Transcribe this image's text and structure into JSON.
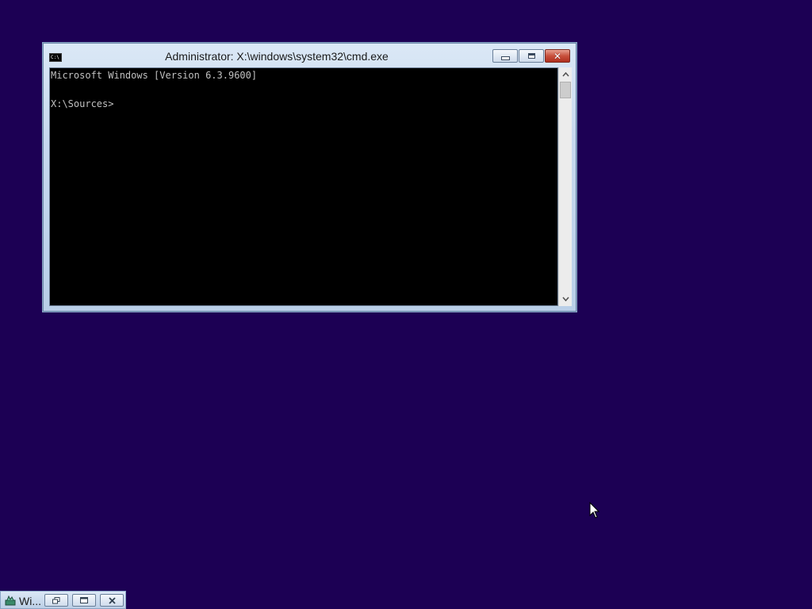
{
  "window": {
    "title": "Administrator: X:\\windows\\system32\\cmd.exe",
    "icon": "cmd-icon",
    "icon_text": "C:\\",
    "buttons": {
      "minimize": "minimize-icon",
      "maximize": "maximize-icon",
      "close": "close-icon"
    }
  },
  "console": {
    "lines": [
      "Microsoft Windows [Version 6.3.9600]",
      "",
      "X:\\Sources>"
    ],
    "background": "#000000",
    "foreground": "#c0c0c0"
  },
  "minimized_window": {
    "title": "Wi...",
    "icon": "setup-icon"
  },
  "colors": {
    "desktop": "#1c0054",
    "close_button": "#c8503c"
  }
}
